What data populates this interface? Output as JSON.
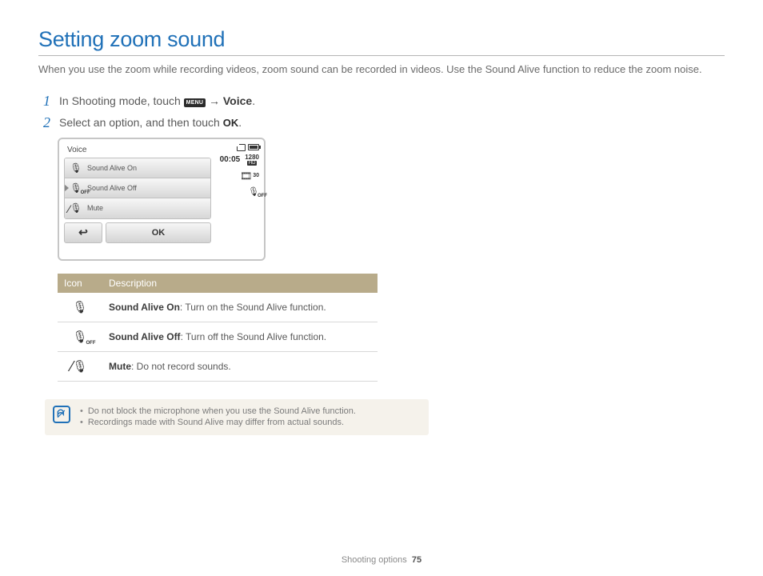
{
  "title": "Setting zoom sound",
  "intro": "When you use the zoom while recording videos, zoom sound can be recorded in videos. Use the Sound Alive function to reduce the zoom noise.",
  "steps": {
    "s1": {
      "num": "1",
      "prefix": "In Shooting mode, touch ",
      "menu_chip": "MENU",
      "arrow": " → ",
      "target": "Voice",
      "suffix": "."
    },
    "s2": {
      "num": "2",
      "prefix": "Select an option, and then touch ",
      "ok": "OK",
      "suffix": "."
    }
  },
  "camera": {
    "panel_title": "Voice",
    "items": [
      {
        "label": "Sound Alive On",
        "icon": "mic-on",
        "selected": false
      },
      {
        "label": "Sound Alive Off",
        "icon": "mic-off",
        "selected": true
      },
      {
        "label": "Mute",
        "icon": "mic-mute",
        "selected": false
      }
    ],
    "back": "↩",
    "ok": "OK",
    "time": "00:05",
    "res_num": "1280",
    "res_hd": "HD",
    "fps": "30"
  },
  "table": {
    "header_icon": "Icon",
    "header_desc": "Description",
    "rows": [
      {
        "icon": "mic-on",
        "name": "Sound Alive On",
        "desc": ": Turn on the Sound Alive function."
      },
      {
        "icon": "mic-off",
        "name": "Sound Alive Off",
        "desc": ": Turn off the Sound Alive function."
      },
      {
        "icon": "mic-mute",
        "name": "Mute",
        "desc": ": Do not record sounds."
      }
    ],
    "off_label": "OFF"
  },
  "note": {
    "bullets": [
      "Do not block the microphone when you use the Sound Alive function.",
      "Recordings made with Sound Alive may differ from actual sounds."
    ]
  },
  "footer": {
    "section": "Shooting options",
    "page": "75"
  }
}
